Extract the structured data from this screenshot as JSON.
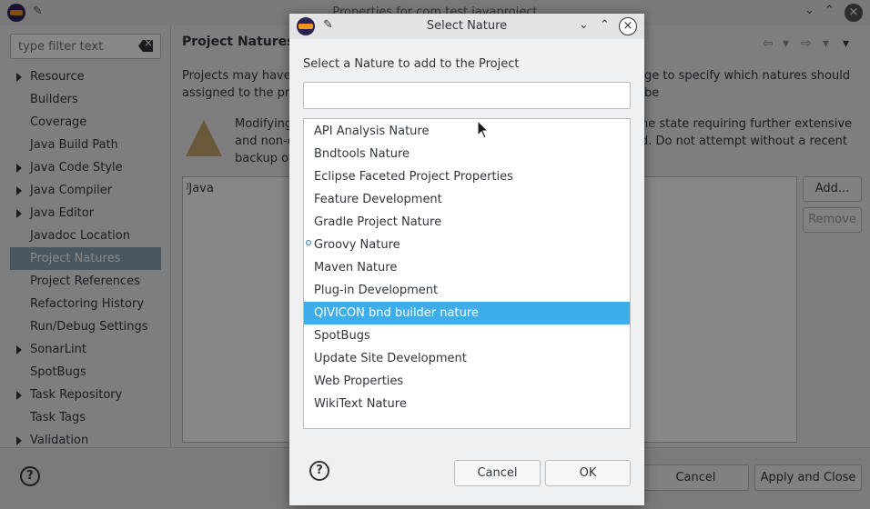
{
  "background": {
    "window_title": "Properties for com.test.javaproject",
    "filter_placeholder": "type filter text",
    "tree": [
      {
        "label": "Resource",
        "expandable": true
      },
      {
        "label": "Builders",
        "expandable": false
      },
      {
        "label": "Coverage",
        "expandable": false
      },
      {
        "label": "Java Build Path",
        "expandable": false
      },
      {
        "label": "Java Code Style",
        "expandable": true
      },
      {
        "label": "Java Compiler",
        "expandable": true
      },
      {
        "label": "Java Editor",
        "expandable": true
      },
      {
        "label": "Javadoc Location",
        "expandable": false
      },
      {
        "label": "Project Natures",
        "expandable": false,
        "selected": true
      },
      {
        "label": "Project References",
        "expandable": false
      },
      {
        "label": "Refactoring History",
        "expandable": false
      },
      {
        "label": "Run/Debug Settings",
        "expandable": false
      },
      {
        "label": "SonarLint",
        "expandable": true
      },
      {
        "label": "SpotBugs",
        "expandable": false
      },
      {
        "label": "Task Repository",
        "expandable": true
      },
      {
        "label": "Task Tags",
        "expandable": false
      },
      {
        "label": "Validation",
        "expandable": true
      }
    ],
    "page_title": "Project Natures",
    "description_line1": "Projects may have m",
    "description_line1_end": "ge to specify which natures should be",
    "description_line2": "assigned to the pro",
    "warning_line1": "Modifying",
    "warning_line1_end": "he state requiring further extensive",
    "warning_line2": "and non-c",
    "warning_line2_end": "d. Do not attempt without a recent",
    "warning_line3": "backup of",
    "natures": [
      "Java"
    ],
    "add_button": "Add...",
    "remove_button": "Remove",
    "cancel_button": "Cancel",
    "apply_close_button": "Apply and Close"
  },
  "dialog": {
    "title": "Select Nature",
    "label": "Select a Nature to add to the Project",
    "search_value": "",
    "items": [
      {
        "label": "API Analysis Nature"
      },
      {
        "label": "Bndtools Nature"
      },
      {
        "label": "Eclipse Faceted Project Properties"
      },
      {
        "label": "Feature Development"
      },
      {
        "label": "Gradle Project Nature"
      },
      {
        "label": "Groovy Nature",
        "overlay": true
      },
      {
        "label": "Maven Nature"
      },
      {
        "label": "Plug-in Development"
      },
      {
        "label": "QIVICON bnd builder nature",
        "selected": true
      },
      {
        "label": "SpotBugs"
      },
      {
        "label": "Update Site Development"
      },
      {
        "label": "Web Properties"
      },
      {
        "label": "WikiText Nature"
      }
    ],
    "help_label": "?",
    "cancel_button": "Cancel",
    "ok_button": "OK"
  },
  "colors": {
    "selection": "#3daee9",
    "tree_selection": "#8fa5b6",
    "text": "#31363b"
  }
}
